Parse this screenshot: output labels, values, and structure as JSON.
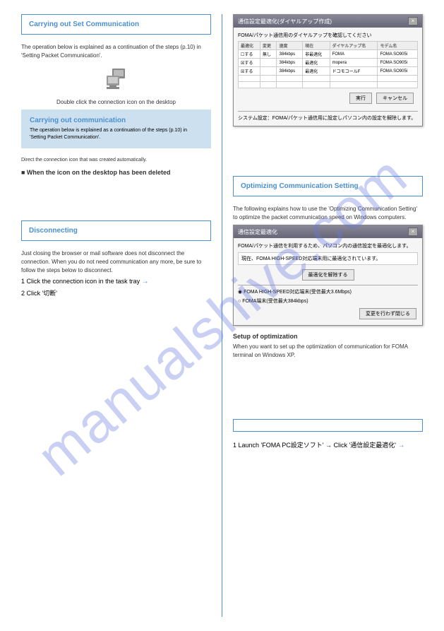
{
  "watermark": "manualshive.com",
  "left": {
    "box1": {
      "title": "Carrying out Set Communication"
    },
    "body1": "The operation below is explained as a continuation of the steps (p.10) in 'Setting Packet Communication'.",
    "icon_caption": "Double click the connection icon on the desktop",
    "box_filled": {
      "title": "Carrying out communication",
      "body": "The operation below is explained as a continuation of the steps (p.10) in 'Setting Packet Communication'."
    },
    "note1": "Direct the connection icon that was created automatically.",
    "note2": "■ When the icon on the desktop has been deleted",
    "box2": {
      "title": "Disconnecting"
    },
    "body3": "Just closing the browser or mail software does not disconnect the connection. When you do not need communication any more, be sure to follow the steps below to disconnect.",
    "step1_num": "1",
    "step1_text": "Click the connection icon in the task tray",
    "arrow1": "→",
    "step2_num": "2",
    "step2_text": "Click '切断'"
  },
  "right": {
    "dialog1": {
      "title": "通信設定最適化(ダイヤルアップ作成)",
      "subtitle": "FOMA/パケット通信用のダイヤルアップを確認してください",
      "table": {
        "headers": [
          "最適化",
          "変更",
          "速度",
          "現在",
          "ダイヤルアップ名",
          "モデム名"
        ],
        "rows": [
          [
            "☐する",
            "無し",
            "384kbps",
            "非最適化",
            "FOMA",
            "FOMA SO905i"
          ],
          [
            "☒する",
            "",
            "384kbps",
            "最適化",
            "mopera",
            "FOMA SO905i"
          ],
          [
            "☒する",
            "",
            "384kbps",
            "最適化",
            "ドコモコールF",
            "FOMA SO905i"
          ]
        ]
      },
      "btn_exec": "実行",
      "btn_cancel": "キャンセル",
      "footer": "システム設定：FOMA/パケット通信用に設定しパソコン内の設定を解除します。"
    },
    "box1": {
      "title": "Optimizing Communication Setting"
    },
    "body1": "The following explains how to use the 'Optimizing Communication Setting' to optimize the packet communication speed on Windows computers.",
    "dialog2": {
      "title": "通信設定最適化",
      "msg": "FOMA/パケット通信を利用するため、パソコン内の通信設定を最適化します。",
      "status": "現在、FOMA HIGH-SPEED対応端末用に最適化されています。",
      "btn_optimize": "最適化を解除する",
      "radio1": "FOMA HIGH-SPEED対応端末(受信最大3.6Mbps)",
      "radio2": "FOMA端末(受信最大384kbps)",
      "btn_close": "変更を行わず閉じる"
    },
    "subhead1": "Setup of optimization",
    "body2": "When you want to set up the optimization of communication for FOMA terminal on Windows XP.",
    "box2": {
      "title": ""
    },
    "step1_num": "1",
    "step1_text": "Launch 'FOMA PC設定ソフト' → Click '通信設定最適化'",
    "arrow1": "→"
  }
}
